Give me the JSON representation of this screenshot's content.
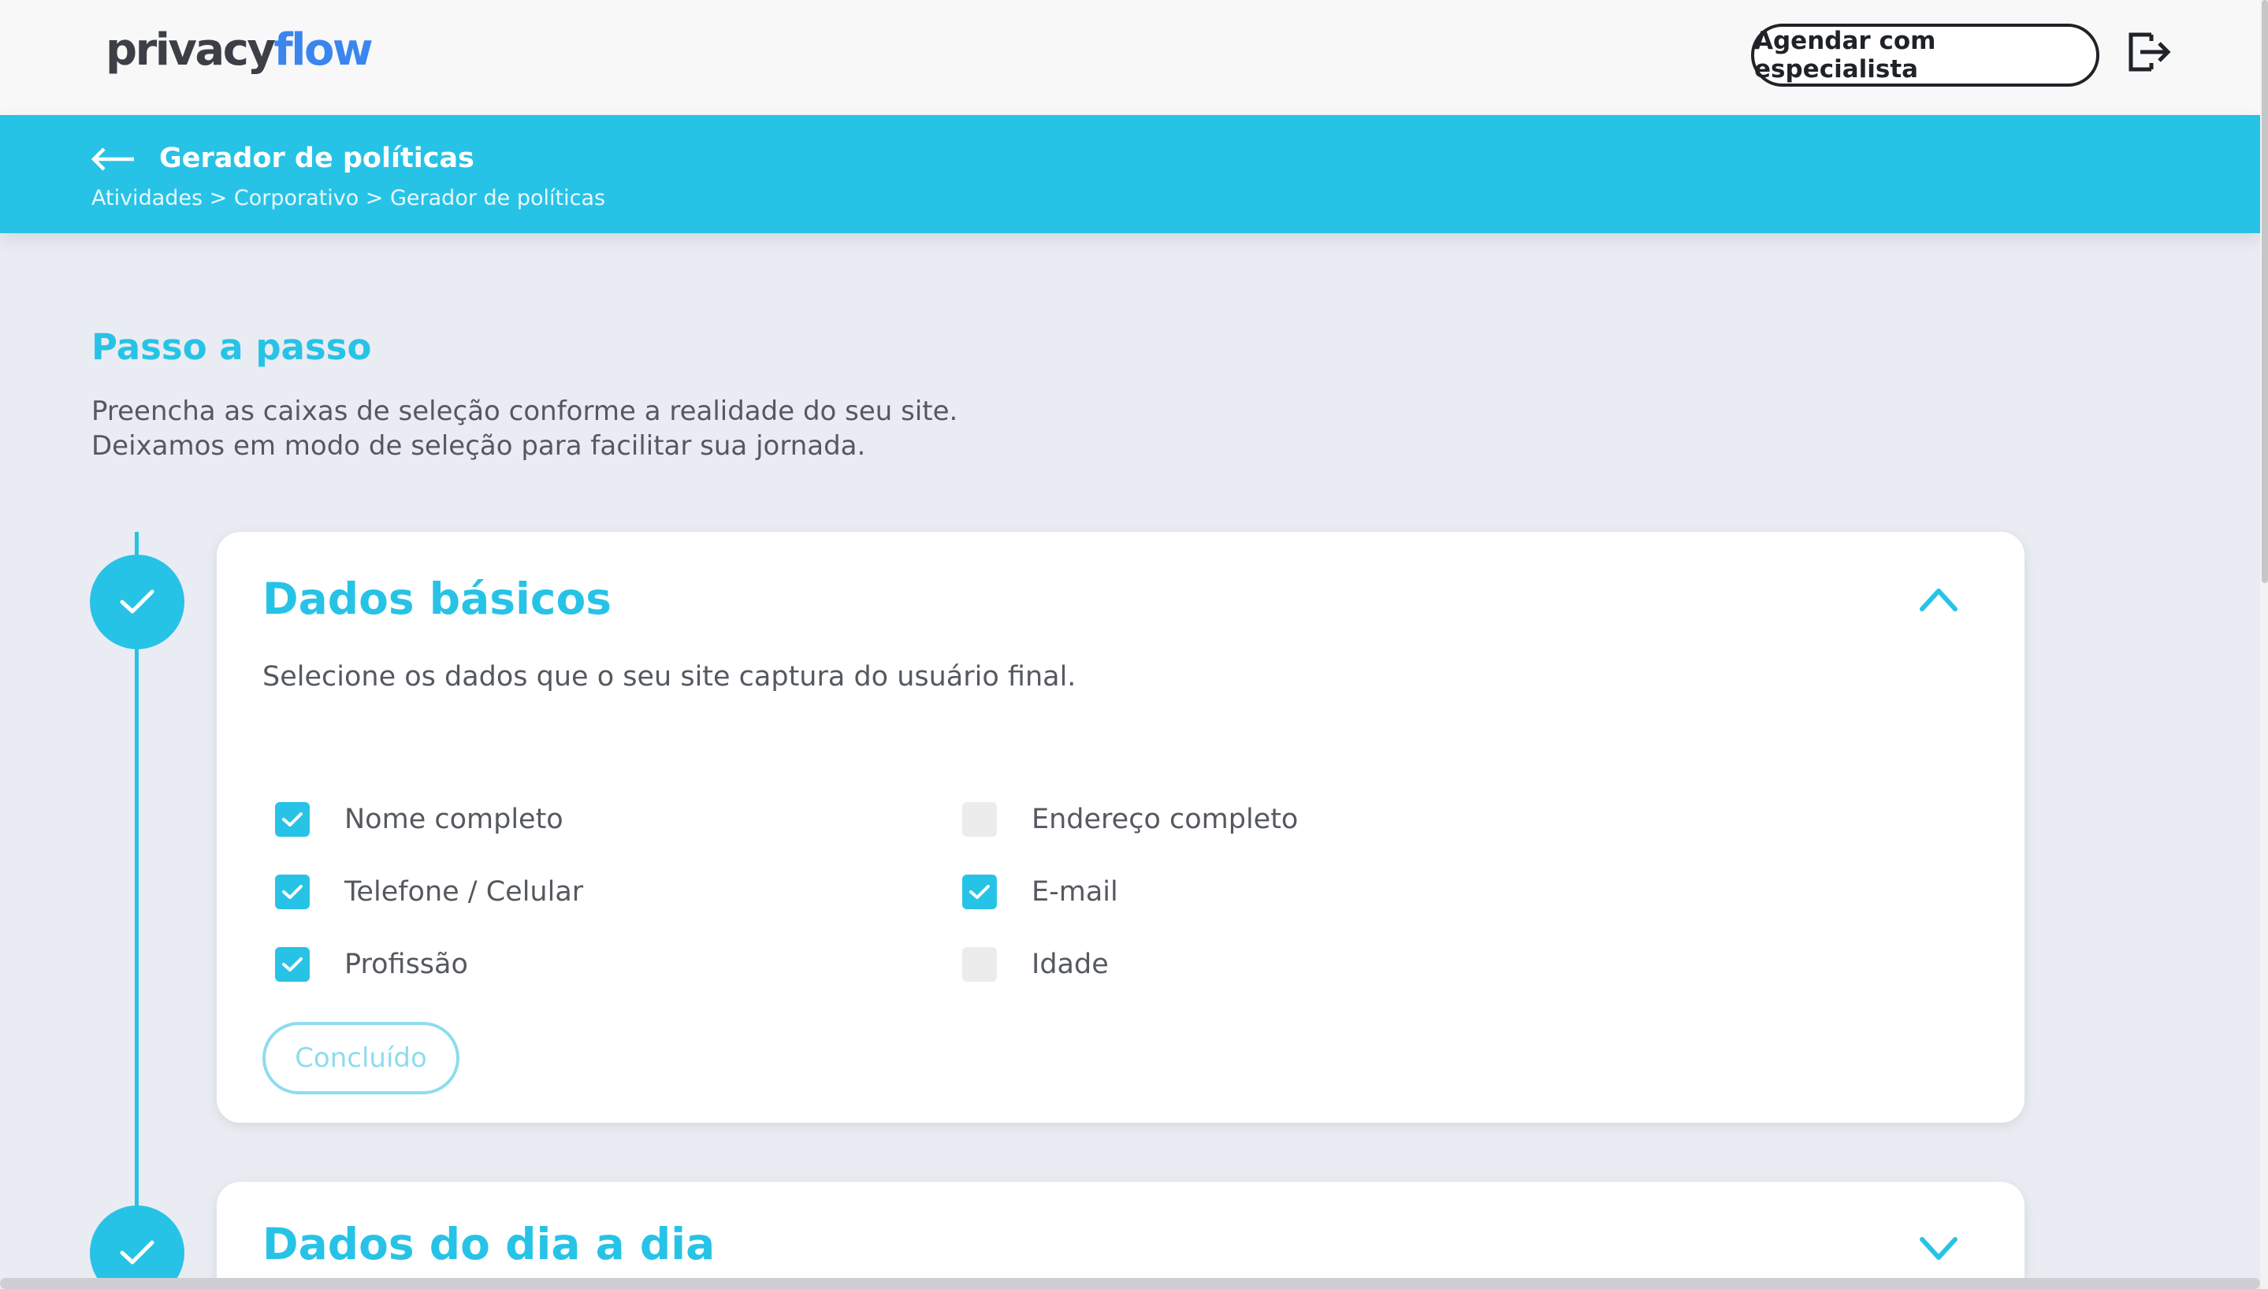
{
  "header": {
    "logo_part1": "privacy",
    "logo_part2": "flow",
    "schedule_label": "Agendar com especialista",
    "logout_icon": "logout-icon"
  },
  "banner": {
    "title": "Gerador de políticas",
    "breadcrumb": "Atividades > Corporativo > Gerador de políticas",
    "back_icon": "arrow-left-icon"
  },
  "intro": {
    "title": "Passo a passo",
    "line1": "Preencha as caixas de seleção conforme a realidade do seu site.",
    "line2": "Deixamos em modo de seleção para facilitar sua jornada."
  },
  "steps": [
    {
      "title": "Dados básicos",
      "subtitle": "Selecione os dados que o seu site captura do usuário final.",
      "expanded": true,
      "options": [
        {
          "label": "Nome completo",
          "checked": true
        },
        {
          "label": "Endereço completo",
          "checked": false
        },
        {
          "label": "Telefone / Celular",
          "checked": true
        },
        {
          "label": "E-mail",
          "checked": true
        },
        {
          "label": "Profissão",
          "checked": true
        },
        {
          "label": "Idade",
          "checked": false
        }
      ],
      "done_label": "Concluído"
    },
    {
      "title": "Dados do dia a dia",
      "expanded": false
    }
  ],
  "colors": {
    "accent": "#27c3e6",
    "logo_blue": "#3a86ee",
    "background": "#eaecf3",
    "text": "#55595f"
  }
}
